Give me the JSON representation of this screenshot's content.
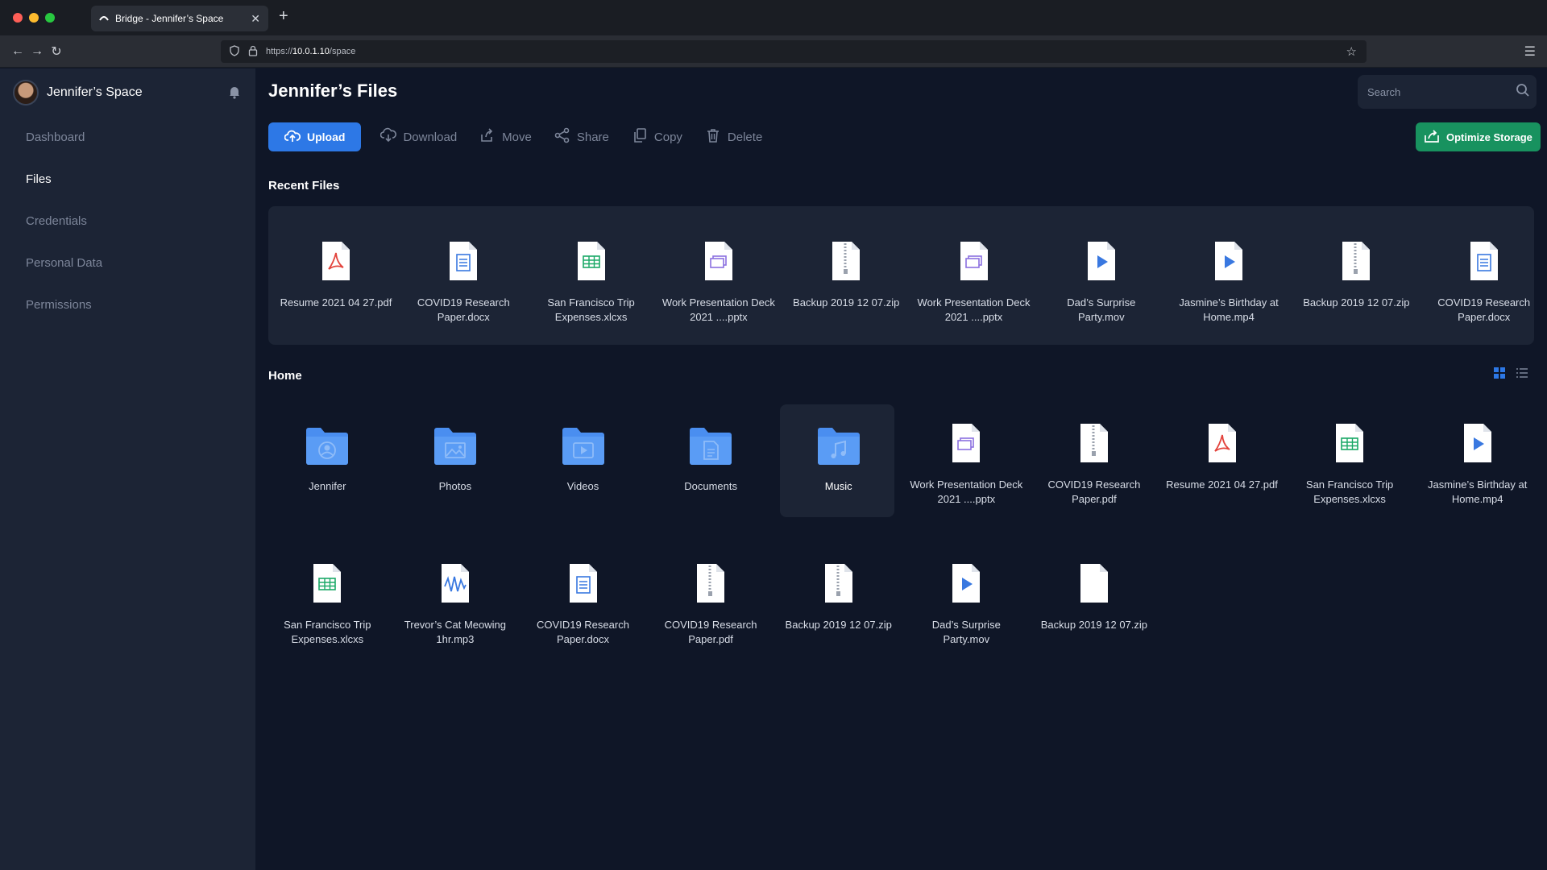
{
  "browser": {
    "tab_title": "Bridge - Jennifer’s Space",
    "url_prefix": "https://",
    "url_host": "10.0.1.10",
    "url_path": "/space"
  },
  "sidebar": {
    "profile_name": "Jennifer’s Space",
    "items": [
      {
        "label": "Dashboard",
        "active": false
      },
      {
        "label": "Files",
        "active": true
      },
      {
        "label": "Credentials",
        "active": false
      },
      {
        "label": "Personal Data",
        "active": false
      },
      {
        "label": "Permissions",
        "active": false
      }
    ]
  },
  "header": {
    "title": "Jennifer’s Files",
    "search_placeholder": "Search"
  },
  "toolbar": {
    "upload": "Upload",
    "download": "Download",
    "move": "Move",
    "share": "Share",
    "copy": "Copy",
    "delete": "Delete",
    "optimize": "Optimize Storage"
  },
  "recent": {
    "label": "Recent Files",
    "files": [
      {
        "name": "Resume 2021 04 27.pdf",
        "type": "pdf"
      },
      {
        "name": "COVID19 Research Paper.docx",
        "type": "doc"
      },
      {
        "name": "San Francisco Trip Expenses.xlcxs",
        "type": "sheet"
      },
      {
        "name": "Work Presentation Deck 2021 ....pptx",
        "type": "slides"
      },
      {
        "name": "Backup 2019 12 07.zip",
        "type": "zip"
      },
      {
        "name": "Work Presentation Deck 2021 ....pptx",
        "type": "slides"
      },
      {
        "name": "Dad’s Surprise Party.mov",
        "type": "video"
      },
      {
        "name": "Jasmine’s Birthday at Home.mp4",
        "type": "video"
      },
      {
        "name": "Backup 2019 12 07.zip",
        "type": "zip"
      },
      {
        "name": "COVID19 Research Paper.docx",
        "type": "doc"
      }
    ]
  },
  "home": {
    "label": "Home",
    "items": [
      {
        "name": "Jennifer",
        "type": "folder-user"
      },
      {
        "name": "Photos",
        "type": "folder-photo"
      },
      {
        "name": "Videos",
        "type": "folder-video"
      },
      {
        "name": "Documents",
        "type": "folder-doc"
      },
      {
        "name": "Music",
        "type": "folder-music",
        "selected": true
      },
      {
        "name": "Work Presentation Deck 2021 ....pptx",
        "type": "slides"
      },
      {
        "name": "COVID19 Research Paper.pdf",
        "type": "zip"
      },
      {
        "name": "Resume 2021 04 27.pdf",
        "type": "pdf"
      },
      {
        "name": "San Francisco Trip Expenses.xlcxs",
        "type": "sheet"
      },
      {
        "name": "Jasmine’s Birthday at Home.mp4",
        "type": "video"
      },
      {
        "name": "San Francisco Trip Expenses.xlcxs",
        "type": "sheet"
      },
      {
        "name": "Trevor’s Cat Meowing 1hr.mp3",
        "type": "audio"
      },
      {
        "name": "COVID19 Research Paper.docx",
        "type": "doc"
      },
      {
        "name": "COVID19 Research Paper.pdf",
        "type": "zip"
      },
      {
        "name": "Backup 2019 12 07.zip",
        "type": "zip"
      },
      {
        "name": "Dad’s Surprise Party.mov",
        "type": "video"
      },
      {
        "name": "Backup 2019 12 07.zip",
        "type": "blank"
      }
    ]
  },
  "colors": {
    "accent": "#2d78e6",
    "success": "#18925f",
    "folder": "#4a8ef0"
  }
}
